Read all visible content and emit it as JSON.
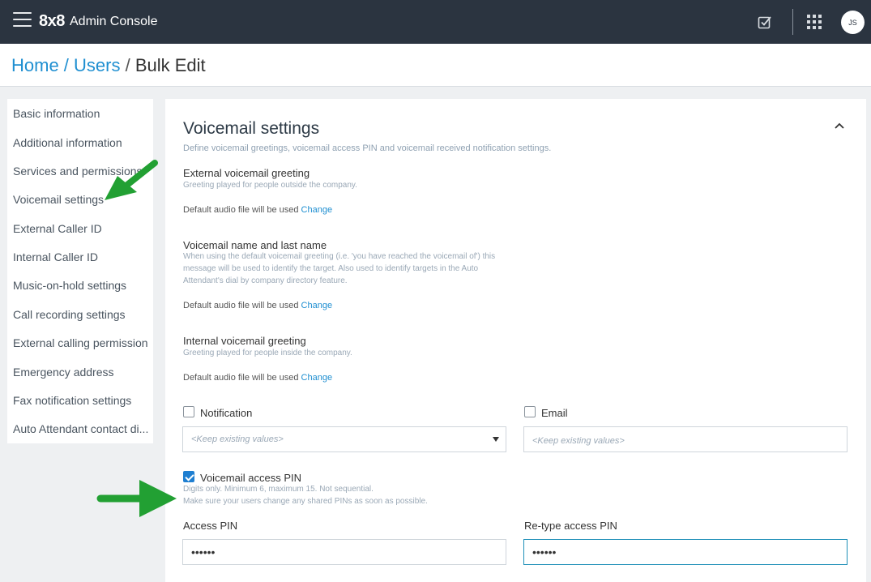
{
  "header": {
    "brand": "8x8",
    "app_title": "Admin Console",
    "avatar_initials": "JS"
  },
  "breadcrumb": {
    "home": "Home",
    "users": "Users",
    "current": "Bulk Edit"
  },
  "sidebar": {
    "items": [
      {
        "label": "Basic information"
      },
      {
        "label": "Additional information"
      },
      {
        "label": "Services and permissions"
      },
      {
        "label": "Voicemail settings"
      },
      {
        "label": "External Caller ID"
      },
      {
        "label": "Internal Caller ID"
      },
      {
        "label": "Music-on-hold settings"
      },
      {
        "label": "Call recording settings"
      },
      {
        "label": "External calling permission"
      },
      {
        "label": "Emergency address"
      },
      {
        "label": "Fax notification settings"
      },
      {
        "label": "Auto Attendant contact di..."
      }
    ]
  },
  "section": {
    "title": "Voicemail settings",
    "description": "Define voicemail greetings, voicemail access PIN and voicemail received notification settings.",
    "external_greeting": {
      "title": "External voicemail greeting",
      "help": "Greeting played for people outside the company.",
      "audio_text": "Default audio file will be used",
      "change_label": "Change"
    },
    "name_greeting": {
      "title": "Voicemail name and last name",
      "help": "When using the default voicemail greeting (i.e. 'you have reached the voicemail of') this message will be used to identify the target. Also used to identify targets in the Auto Attendant's dial by company directory feature.",
      "audio_text": "Default audio file will be used",
      "change_label": "Change"
    },
    "internal_greeting": {
      "title": "Internal voicemail greeting",
      "help": "Greeting played for people inside the company.",
      "audio_text": "Default audio file will be used",
      "change_label": "Change"
    },
    "notification": {
      "label": "Notification",
      "checked": false,
      "placeholder": "<Keep existing values>"
    },
    "email": {
      "label": "Email",
      "checked": false,
      "placeholder": "<Keep existing values>"
    },
    "pin": {
      "label": "Voicemail access PIN",
      "checked": true,
      "help_line1": "Digits only. Minimum 6, maximum 15. Not sequential.",
      "help_line2": "Make sure your users change any shared PINs as soon as possible.",
      "access_label": "Access PIN",
      "access_value": "123456",
      "retype_label": "Re-type access PIN",
      "retype_value": "123456"
    }
  },
  "colors": {
    "topbar": "#2b3440",
    "link": "#1f8fd1",
    "checkbox_checked": "#1f7fd1",
    "annotation_arrow": "#22a033"
  }
}
